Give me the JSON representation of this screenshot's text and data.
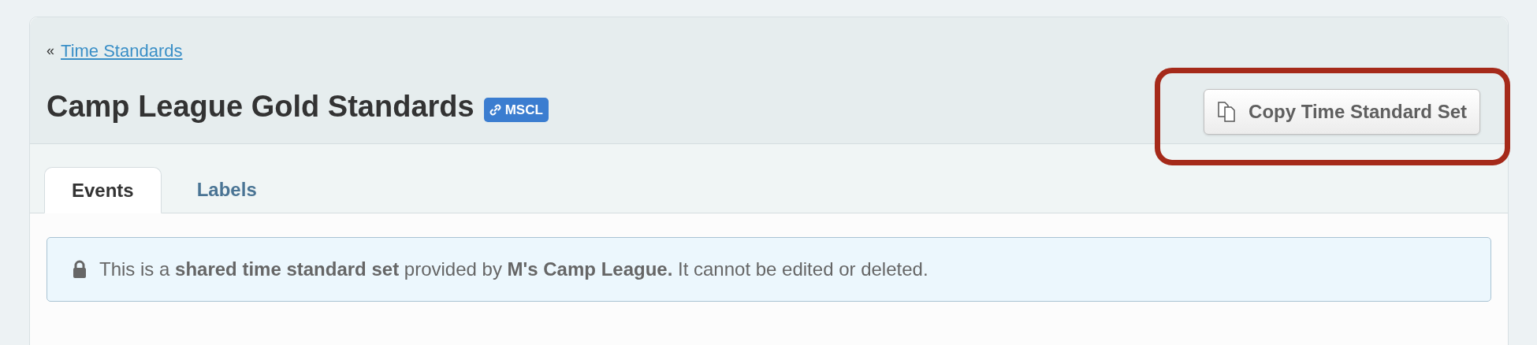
{
  "breadcrumb": {
    "marker": "«",
    "link": "Time Standards"
  },
  "title": "Camp League Gold Standards",
  "badge": {
    "label": "MSCL"
  },
  "copy_button": {
    "label": "Copy Time Standard Set",
    "highlighted": true
  },
  "tabs": [
    {
      "label": "Events",
      "selected": true
    },
    {
      "label": "Labels",
      "selected": false
    }
  ],
  "notice": {
    "text": "This is a **shared time standard set** provided by **M's Camp League.** It cannot be edited or deleted."
  }
}
